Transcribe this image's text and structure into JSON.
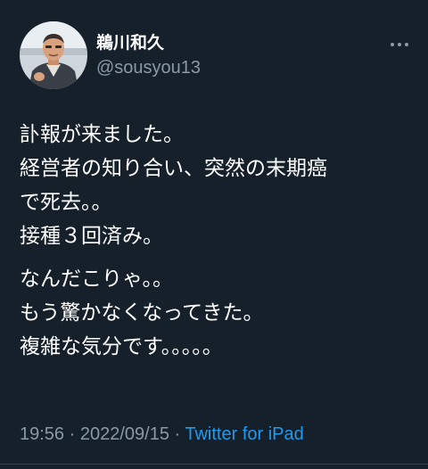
{
  "user": {
    "display_name": "鵜川和久",
    "handle": "@sousyou13"
  },
  "tweet": {
    "paragraphs": [
      [
        "訃報が来ました。",
        "経営者の知り合い、突然の末期癌",
        "で死去。。",
        "接種３回済み。"
      ],
      [
        "なんだこりゃ。。",
        "もう驚かなくなってきた。",
        "複雑な気分です。。。。。"
      ]
    ]
  },
  "meta": {
    "time": "19:56",
    "separator": " · ",
    "date": "2022/09/15",
    "source": "Twitter for iPad"
  },
  "colors": {
    "background": "#15202b",
    "text": "#ffffff",
    "secondary": "#8b98a5",
    "link": "#1d9bf0"
  },
  "icons": {
    "more": "more-horizontal-icon"
  }
}
